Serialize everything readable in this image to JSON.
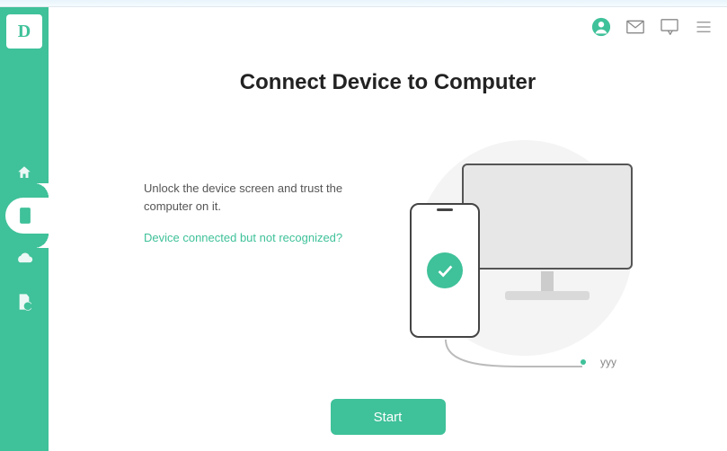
{
  "logo": "D",
  "sidebar": {
    "items": [
      {
        "name": "home-icon"
      },
      {
        "name": "device-icon",
        "active": true
      },
      {
        "name": "cloud-icon"
      },
      {
        "name": "file-icon"
      }
    ]
  },
  "header": {
    "title": "Connect Device to Computer"
  },
  "body": {
    "instruction": "Unlock the device screen and trust the computer on it.",
    "help_link": "Device connected but not recognized?"
  },
  "status": {
    "label": "yyy"
  },
  "actions": {
    "start_label": "Start"
  },
  "colors": {
    "accent": "#3fc199"
  }
}
